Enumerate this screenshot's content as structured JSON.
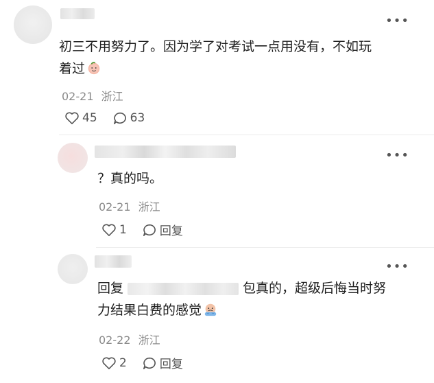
{
  "comments": [
    {
      "text_line1": "初三不用努力了。因为学了对考试一点用没有，不如玩",
      "text_line2": "着过",
      "date": "02-21",
      "location": "浙江",
      "likes": "45",
      "replies": "63",
      "emoji_icon": "peach-face-emoji"
    },
    {
      "text_line1": "？真的吗。",
      "date": "02-21",
      "location": "浙江",
      "likes": "1",
      "reply_label": "回复"
    },
    {
      "reply_prefix": "回复",
      "text_after_redact": "包真的，超级后悔当时努",
      "text_line2": "力结果白费的感觉",
      "date": "02-22",
      "location": "浙江",
      "likes": "2",
      "reply_label": "回复",
      "emoji_icon": "crying-face-emoji"
    }
  ],
  "icons": {
    "like": "heart-outline-icon",
    "comment": "speech-bubble-icon",
    "more": "more-dots-icon"
  },
  "colors": {
    "text": "#1f1f1f",
    "meta": "#8a8a8a",
    "blur": "#e6e6e6"
  }
}
